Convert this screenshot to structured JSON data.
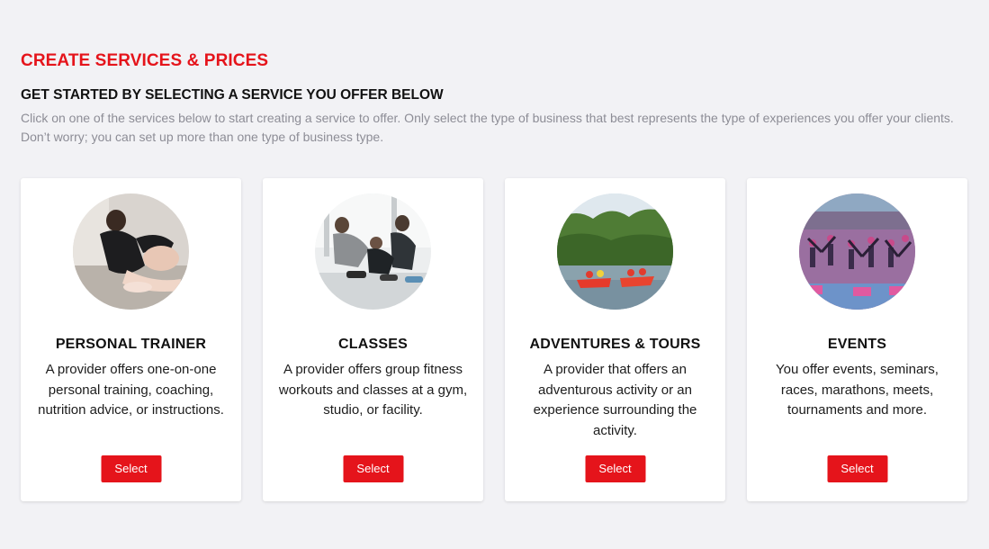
{
  "header": {
    "title": "CREATE SERVICES & PRICES",
    "subtitle": "GET STARTED BY SELECTING A SERVICE YOU OFFER BELOW",
    "description": "Click on one of the services below to start creating a service to offer. Only select the type of business that best represents the type of experiences you offer your clients. Don’t worry; you can set up more than one type of business type."
  },
  "cards": [
    {
      "title": "PERSONAL TRAINER",
      "description": "A provider offers one-on-one personal training, coaching, nutrition advice, or instructions.",
      "button": "Select"
    },
    {
      "title": "CLASSES",
      "description": "A provider offers group fitness workouts and classes at a gym, studio, or facility.",
      "button": "Select"
    },
    {
      "title": "ADVENTURES & TOURS",
      "description": "A provider that offers an adventurous activity or an experience surrounding the activity.",
      "button": "Select"
    },
    {
      "title": "EVENTS",
      "description": "You offer events, seminars, races, marathons, meets, tournaments and more.",
      "button": "Select"
    }
  ],
  "colors": {
    "accent": "#e5141b",
    "background": "#f2f2f5",
    "muted_text": "#8d8d96"
  }
}
